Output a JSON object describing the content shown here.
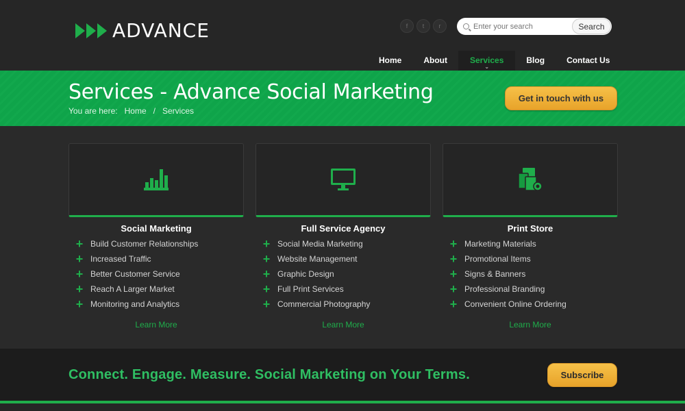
{
  "brand": {
    "logo_text": "ADVANCE",
    "accent": "#1fae4b",
    "button_color": "#f0b43a"
  },
  "header": {
    "social": [
      {
        "icon": "facebook-icon",
        "glyph": "f"
      },
      {
        "icon": "twitter-icon",
        "glyph": "t"
      },
      {
        "icon": "rss-icon",
        "glyph": "r"
      }
    ],
    "search": {
      "placeholder": "Enter your search",
      "button_label": "Search"
    },
    "nav": [
      {
        "label": "Home",
        "active": false
      },
      {
        "label": "About",
        "active": false
      },
      {
        "label": "Services",
        "active": true
      },
      {
        "label": "Blog",
        "active": false
      },
      {
        "label": "Contact Us",
        "active": false
      }
    ]
  },
  "banner": {
    "title": "Services - Advance Social Marketing",
    "breadcrumb": {
      "prefix": "You are here:",
      "home": "Home",
      "separator": "/",
      "current": "Services"
    },
    "cta_label": "Get in touch with us"
  },
  "columns": [
    {
      "icon": "bar-chart-icon",
      "title": "Social Marketing",
      "items": [
        "Build Customer Relationships",
        "Increased Traffic",
        "Better Customer Service",
        "Reach A Larger Market",
        "Monitoring and Analytics"
      ],
      "link": "Learn More"
    },
    {
      "icon": "monitor-icon",
      "title": "Full Service Agency",
      "items": [
        "Social Media Marketing",
        "Website Management",
        "Graphic Design",
        "Full Print Services",
        "Commercial Photography"
      ],
      "link": "Learn More"
    },
    {
      "icon": "print-devices-icon",
      "title": "Print Store",
      "items": [
        "Marketing Materials",
        "Promotional Items",
        "Signs & Banners",
        "Professional Branding",
        "Convenient Online Ordering"
      ],
      "link": "Learn More"
    }
  ],
  "footer_strip": {
    "tagline": "Connect. Engage. Measure. Social Marketing on Your Terms.",
    "subscribe_label": "Subscribe"
  }
}
